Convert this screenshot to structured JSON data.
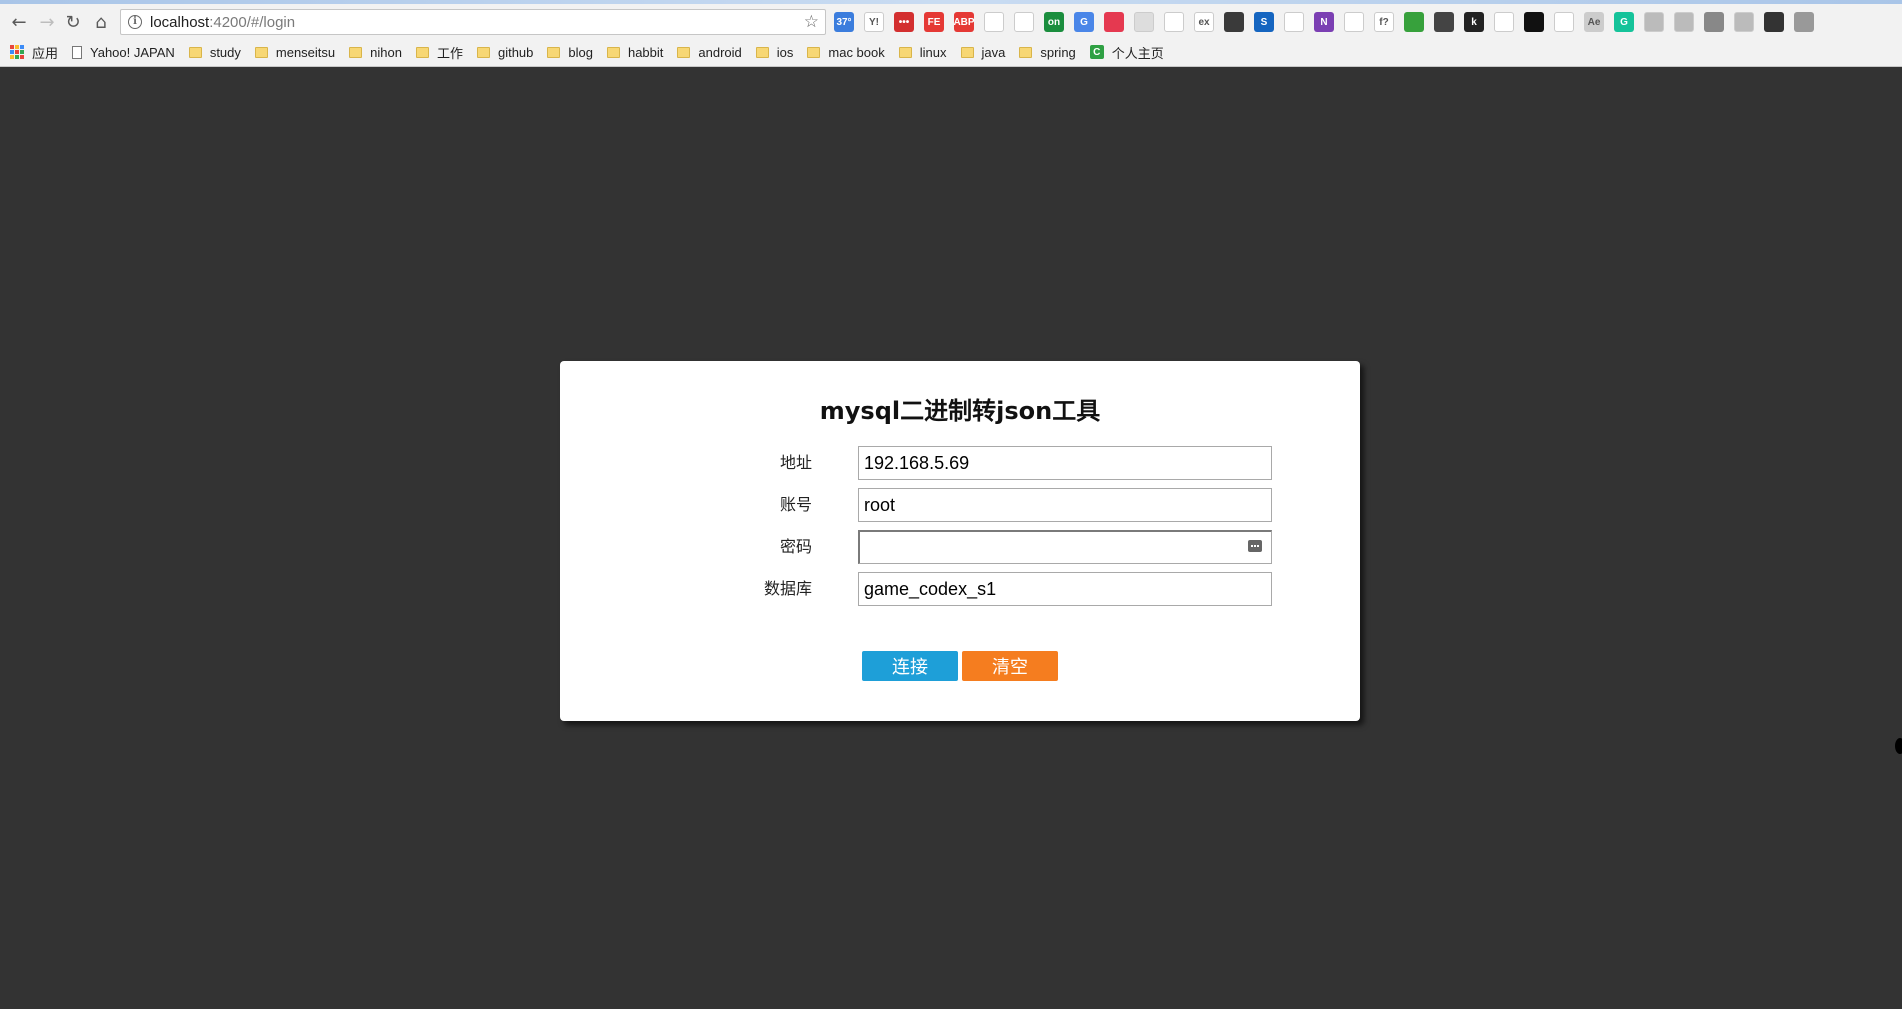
{
  "browser": {
    "url_host": "localhost",
    "url_rest": ":4200/#/login",
    "extensions": [
      {
        "name": "weather-icon",
        "text": "37°",
        "color": "#3b7ddd"
      },
      {
        "name": "yahoo-icon",
        "text": "Y!",
        "color": "#ffffff"
      },
      {
        "name": "ext-red-dots-icon",
        "text": "•••",
        "color": "#d32f2f"
      },
      {
        "name": "fe-icon",
        "text": "FE",
        "color": "#e53935"
      },
      {
        "name": "adblock-icon",
        "text": "ABP",
        "color": "#e53935"
      },
      {
        "name": "eyedropper-icon",
        "text": "",
        "color": "#ffffff"
      },
      {
        "name": "refresh-ext-icon",
        "text": "",
        "color": "#ffffff"
      },
      {
        "name": "on-icon",
        "text": "on",
        "color": "#1b8e3e"
      },
      {
        "name": "translate-icon",
        "text": "G",
        "color": "#4a86e8"
      },
      {
        "name": "pocket-icon",
        "text": "",
        "color": "#e53950"
      },
      {
        "name": "grey-ext-icon",
        "text": "",
        "color": "#dddddd"
      },
      {
        "name": "bird-icon",
        "text": "",
        "color": "#ffffff"
      },
      {
        "name": "ex-icon",
        "text": "ex",
        "color": "#ffffff"
      },
      {
        "name": "cat-icon",
        "text": "",
        "color": "#3a3a3a"
      },
      {
        "name": "s-icon",
        "text": "S",
        "color": "#1565c0"
      },
      {
        "name": "tree-icon",
        "text": "",
        "color": "#ffffff"
      },
      {
        "name": "onenote-icon",
        "text": "N",
        "color": "#7b3fb3"
      },
      {
        "name": "panel-icon",
        "text": "",
        "color": "#ffffff"
      },
      {
        "name": "fx-icon",
        "text": "f?",
        "color": "#ffffff"
      },
      {
        "name": "green-ext-icon",
        "text": "",
        "color": "#37a13c"
      },
      {
        "name": "qr-icon",
        "text": "",
        "color": "#444444"
      },
      {
        "name": "k-icon",
        "text": "k",
        "color": "#222222"
      },
      {
        "name": "penguin-icon",
        "text": "",
        "color": "#ffffff"
      },
      {
        "name": "tampermonkey-icon",
        "text": "",
        "color": "#111111"
      },
      {
        "name": "link-icon",
        "text": "",
        "color": "#ffffff"
      },
      {
        "name": "ae-icon",
        "text": "Ae",
        "color": "#cccccc"
      },
      {
        "name": "grammarly-icon",
        "text": "G",
        "color": "#15c39a"
      },
      {
        "name": "shield-ext-icon",
        "text": "",
        "color": "#bbbbbb"
      },
      {
        "name": "person-ext-icon",
        "text": "",
        "color": "#bbbbbb"
      },
      {
        "name": "spy-icon",
        "text": "",
        "color": "#888888"
      },
      {
        "name": "image-ext-icon",
        "text": "",
        "color": "#bbbbbb"
      },
      {
        "name": "download-icon",
        "text": "",
        "color": "#333333"
      },
      {
        "name": "screen-ext-icon",
        "text": "",
        "color": "#999999"
      }
    ],
    "bookmarks": {
      "apps": "应用",
      "items": [
        {
          "label": "Yahoo! JAPAN",
          "kind": "page"
        },
        {
          "label": "study",
          "kind": "folder"
        },
        {
          "label": "menseitsu",
          "kind": "folder"
        },
        {
          "label": "nihon",
          "kind": "folder"
        },
        {
          "label": "工作",
          "kind": "folder"
        },
        {
          "label": "github",
          "kind": "folder"
        },
        {
          "label": "blog",
          "kind": "folder"
        },
        {
          "label": "habbit",
          "kind": "folder"
        },
        {
          "label": "android",
          "kind": "folder"
        },
        {
          "label": "ios",
          "kind": "folder"
        },
        {
          "label": "mac book",
          "kind": "folder"
        },
        {
          "label": "linux",
          "kind": "folder"
        },
        {
          "label": "java",
          "kind": "folder"
        },
        {
          "label": "spring",
          "kind": "folder"
        },
        {
          "label": "个人主页",
          "kind": "green"
        }
      ]
    }
  },
  "login": {
    "title": "mysql二进制转json工具",
    "fields": {
      "address": {
        "label": "地址",
        "value": "192.168.5.69"
      },
      "account": {
        "label": "账号",
        "value": "root"
      },
      "password": {
        "label": "密码",
        "value": ""
      },
      "database": {
        "label": "数据库",
        "value": "game_codex_s1"
      }
    },
    "buttons": {
      "connect": "连接",
      "clear": "清空"
    }
  }
}
